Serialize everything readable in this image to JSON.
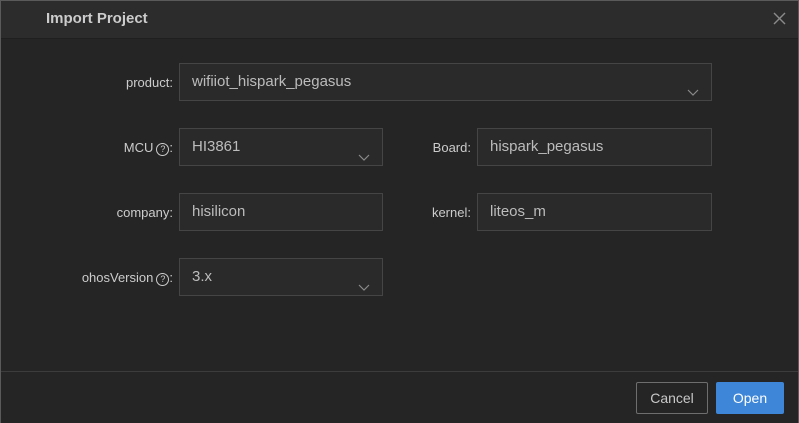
{
  "dialog": {
    "title": "Import Project",
    "close_icon": "close-icon"
  },
  "form": {
    "product": {
      "label": "product",
      "colon": ":",
      "value": "wifiiot_hispark_pegasus"
    },
    "mcu": {
      "label": "MCU",
      "colon": ":",
      "help_glyph": "?",
      "value": "HI3861"
    },
    "board": {
      "label": "Board",
      "colon": ":",
      "value": "hispark_pegasus"
    },
    "company": {
      "label": "company",
      "colon": ":",
      "value": "hisilicon"
    },
    "kernel": {
      "label": "kernel",
      "colon": ":",
      "value": "liteos_m"
    },
    "ohos_version": {
      "label": "ohosVersion",
      "colon": ":",
      "help_glyph": "?",
      "value": "3.x"
    }
  },
  "footer": {
    "cancel_label": "Cancel",
    "open_label": "Open"
  },
  "colors": {
    "primary_button": "#3d86d8",
    "background": "#252526",
    "field_border": "#454545"
  }
}
